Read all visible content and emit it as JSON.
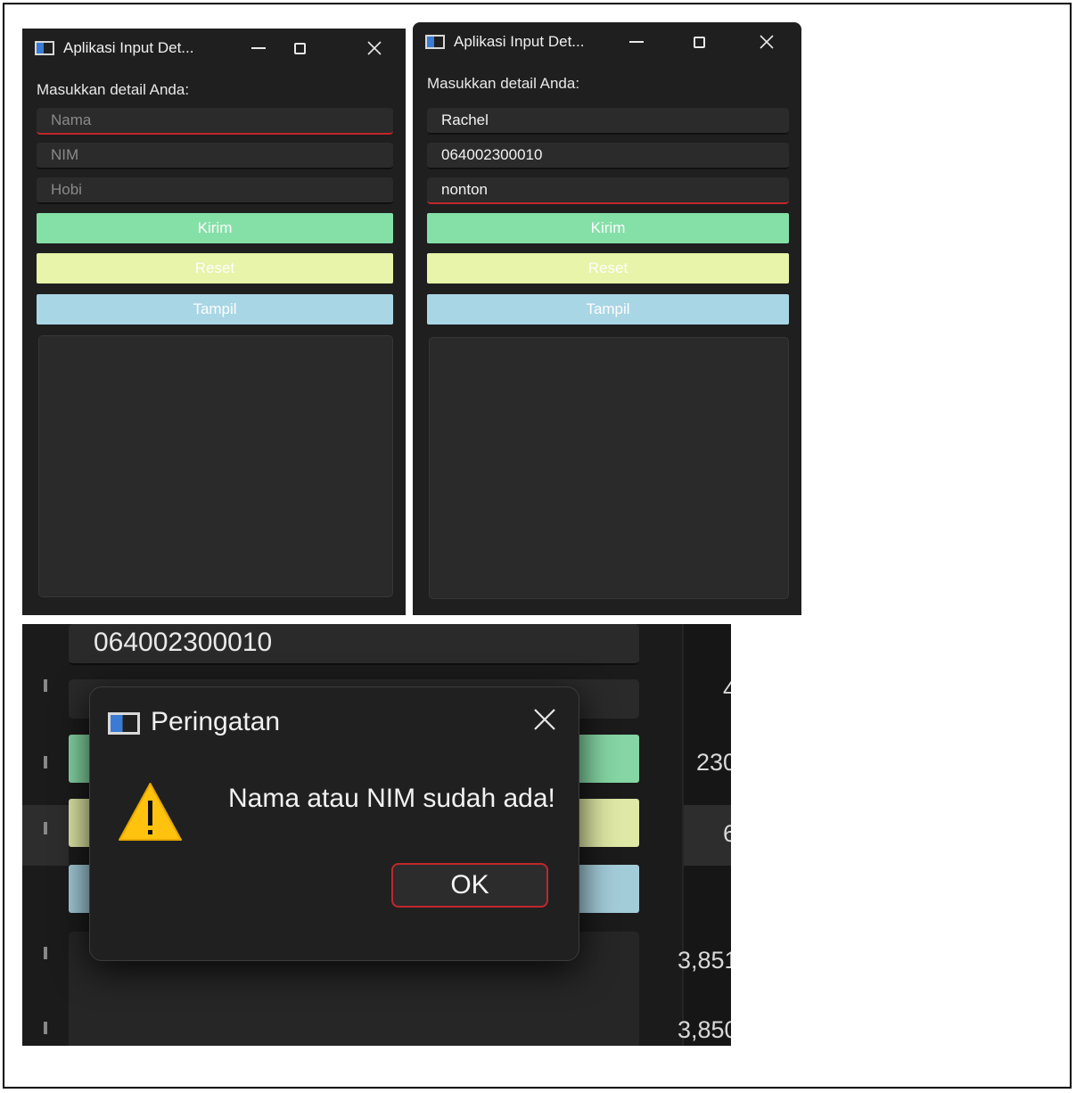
{
  "window1": {
    "title": "Aplikasi Input Det...",
    "prompt": "Masukkan detail Anda:",
    "nama_placeholder": "Nama",
    "nim_placeholder": "NIM",
    "hobi_placeholder": "Hobi",
    "kirim_label": "Kirim",
    "reset_label": "Reset",
    "tampil_label": "Tampil"
  },
  "window2": {
    "title": "Aplikasi Input Det...",
    "prompt": "Masukkan detail Anda:",
    "nama_value": "Rachel",
    "nim_value": "064002300010",
    "hobi_value": "nonton",
    "kirim_label": "Kirim",
    "reset_label": "Reset",
    "tampil_label": "Tampil"
  },
  "zoom": {
    "nim_value": "064002300010",
    "right_values": [
      "4",
      "230",
      "6",
      "3,851",
      "3,850"
    ]
  },
  "dialog": {
    "title": "Peringatan",
    "message": "Nama atau NIM sudah ada!",
    "ok_label": "OK"
  },
  "colors": {
    "kirim": "#85e0a8",
    "reset": "#e7f4a9",
    "tampil": "#a9d6e5",
    "focus_underline": "#c0272d",
    "window_bg": "#1f1f1f"
  },
  "icons": [
    "app-window-icon",
    "minimize-icon",
    "maximize-icon",
    "close-icon",
    "warning-icon"
  ]
}
